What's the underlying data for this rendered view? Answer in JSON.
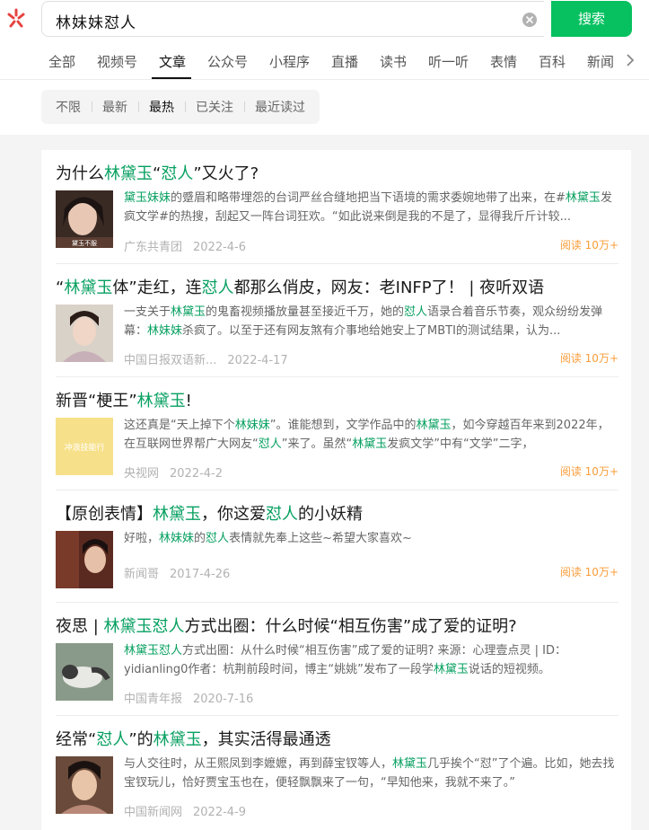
{
  "search": {
    "query": "林妹妹怼人",
    "button_label": "搜索"
  },
  "tabs": [
    {
      "label": "全部"
    },
    {
      "label": "视频号"
    },
    {
      "label": "文章"
    },
    {
      "label": "公众号"
    },
    {
      "label": "小程序"
    },
    {
      "label": "直播"
    },
    {
      "label": "读书"
    },
    {
      "label": "听一听"
    },
    {
      "label": "表情"
    },
    {
      "label": "百科"
    },
    {
      "label": "新闻"
    }
  ],
  "active_tab": "文章",
  "filters": [
    {
      "label": "不限"
    },
    {
      "label": "最新"
    },
    {
      "label": "最热"
    },
    {
      "label": "已关注"
    },
    {
      "label": "最近读过"
    }
  ],
  "active_filter": "最热",
  "colors": {
    "accent_green": "#07c160",
    "highlight": "#07a060",
    "reads_orange": "#fa9d3b"
  },
  "results": [
    {
      "title": [
        {
          "t": "为什么"
        },
        {
          "t": "林黛玉",
          "hl": true
        },
        {
          "t": "“"
        },
        {
          "t": "怼人",
          "hl": true
        },
        {
          "t": "”又火了?"
        }
      ],
      "snippet": [
        {
          "t": "黛玉妹妹",
          "hl": true
        },
        {
          "t": "的蹙眉和略带埋怨的台词严丝合缝地把当下语境的需求委婉地带了出来，在#"
        },
        {
          "t": "林黛玉",
          "hl": true
        },
        {
          "t": "发疯文学#的热搜，刮起又一阵台词狂欢。“如此说来倒是我的不是了，显得我斤斤计较..."
        }
      ],
      "thumb_caption": "黛玉不服",
      "source": "广东共青团",
      "date": "2022-4-6",
      "reads": "阅读 10万+"
    },
    {
      "title": [
        {
          "t": "“"
        },
        {
          "t": "林黛玉",
          "hl": true
        },
        {
          "t": "体”走红，连"
        },
        {
          "t": "怼人",
          "hl": true
        },
        {
          "t": "都那么俏皮，网友：老INFP了！ | 夜听双语"
        }
      ],
      "snippet": [
        {
          "t": "一支关于"
        },
        {
          "t": "林黛玉",
          "hl": true
        },
        {
          "t": "的鬼畜视频播放量甚至接近千万，她的"
        },
        {
          "t": "怼人",
          "hl": true
        },
        {
          "t": "语录合着音乐节奏，观众纷纷发弹幕："
        },
        {
          "t": "林妹妹",
          "hl": true
        },
        {
          "t": "杀疯了。以至于还有网友煞有介事地给她安上了MBTI的测试结果，认为..."
        }
      ],
      "thumb_caption": "",
      "source": "中国日报双语新...",
      "date": "2022-4-17",
      "reads": "阅读 10万+"
    },
    {
      "title": [
        {
          "t": "新晋“梗王”"
        },
        {
          "t": "林黛玉",
          "hl": true
        },
        {
          "t": "!"
        }
      ],
      "snippet": [
        {
          "t": "这还真是“天上掉下个"
        },
        {
          "t": "林妹妹",
          "hl": true
        },
        {
          "t": "”。谁能想到，文学作品中的"
        },
        {
          "t": "林黛玉",
          "hl": true
        },
        {
          "t": "，如今穿越百年来到2022年，在互联网世界帮广大网友“"
        },
        {
          "t": "怼人",
          "hl": true
        },
        {
          "t": "”来了。虽然“"
        },
        {
          "t": "林黛玉",
          "hl": true
        },
        {
          "t": "发疯文学”中有“文学”二字，"
        }
      ],
      "thumb_caption": "冲浪技能行",
      "source": "央视网",
      "date": "2022-4-2",
      "reads": "阅读 10万+"
    },
    {
      "title": [
        {
          "t": "【原创表情】"
        },
        {
          "t": "林黛玉",
          "hl": true
        },
        {
          "t": "，你这爱"
        },
        {
          "t": "怼人",
          "hl": true
        },
        {
          "t": "的小妖精"
        }
      ],
      "snippet": [
        {
          "t": "好啦，"
        },
        {
          "t": "林妹妹",
          "hl": true
        },
        {
          "t": "的"
        },
        {
          "t": "怼人",
          "hl": true
        },
        {
          "t": "表情就先奉上这些~希望大家喜欢~"
        }
      ],
      "thumb_caption": "",
      "source": "新闻哥",
      "date": "2017-4-26",
      "reads": "阅读 10万+"
    },
    {
      "title": [
        {
          "t": "夜思 | "
        },
        {
          "t": "林黛玉怼人",
          "hl": true
        },
        {
          "t": "方式出圈：什么时候“相互伤害”成了爱的证明?"
        }
      ],
      "snippet": [
        {
          "t": "林黛玉怼人",
          "hl": true
        },
        {
          "t": "方式出圈：从什么时候“相互伤害”成了爱的证明? 来源：心理壹点灵 | ID：yidianling0作者：杭荆前段时间，博主“姚姚”发布了一段学"
        },
        {
          "t": "林黛玉",
          "hl": true
        },
        {
          "t": "说话的短视频。"
        }
      ],
      "thumb_caption": "",
      "source": "中国青年报",
      "date": "2020-7-16",
      "reads": ""
    },
    {
      "title": [
        {
          "t": "经常“"
        },
        {
          "t": "怼人",
          "hl": true
        },
        {
          "t": "”的"
        },
        {
          "t": "林黛玉",
          "hl": true
        },
        {
          "t": "，其实活得最通透"
        }
      ],
      "snippet": [
        {
          "t": "与人交往时，从王熙凤到李嬷嬷，再到薛宝钗等人，"
        },
        {
          "t": "林黛玉",
          "hl": true
        },
        {
          "t": "几乎挨个“怼”了个遍。比如，她去找宝钗玩儿，恰好贾宝玉也在，便轻飘飘来了一句，“早知他来，我就不来了。”"
        }
      ],
      "thumb_caption": "",
      "source": "中国新闻网",
      "date": "2022-4-9",
      "reads": ""
    }
  ]
}
